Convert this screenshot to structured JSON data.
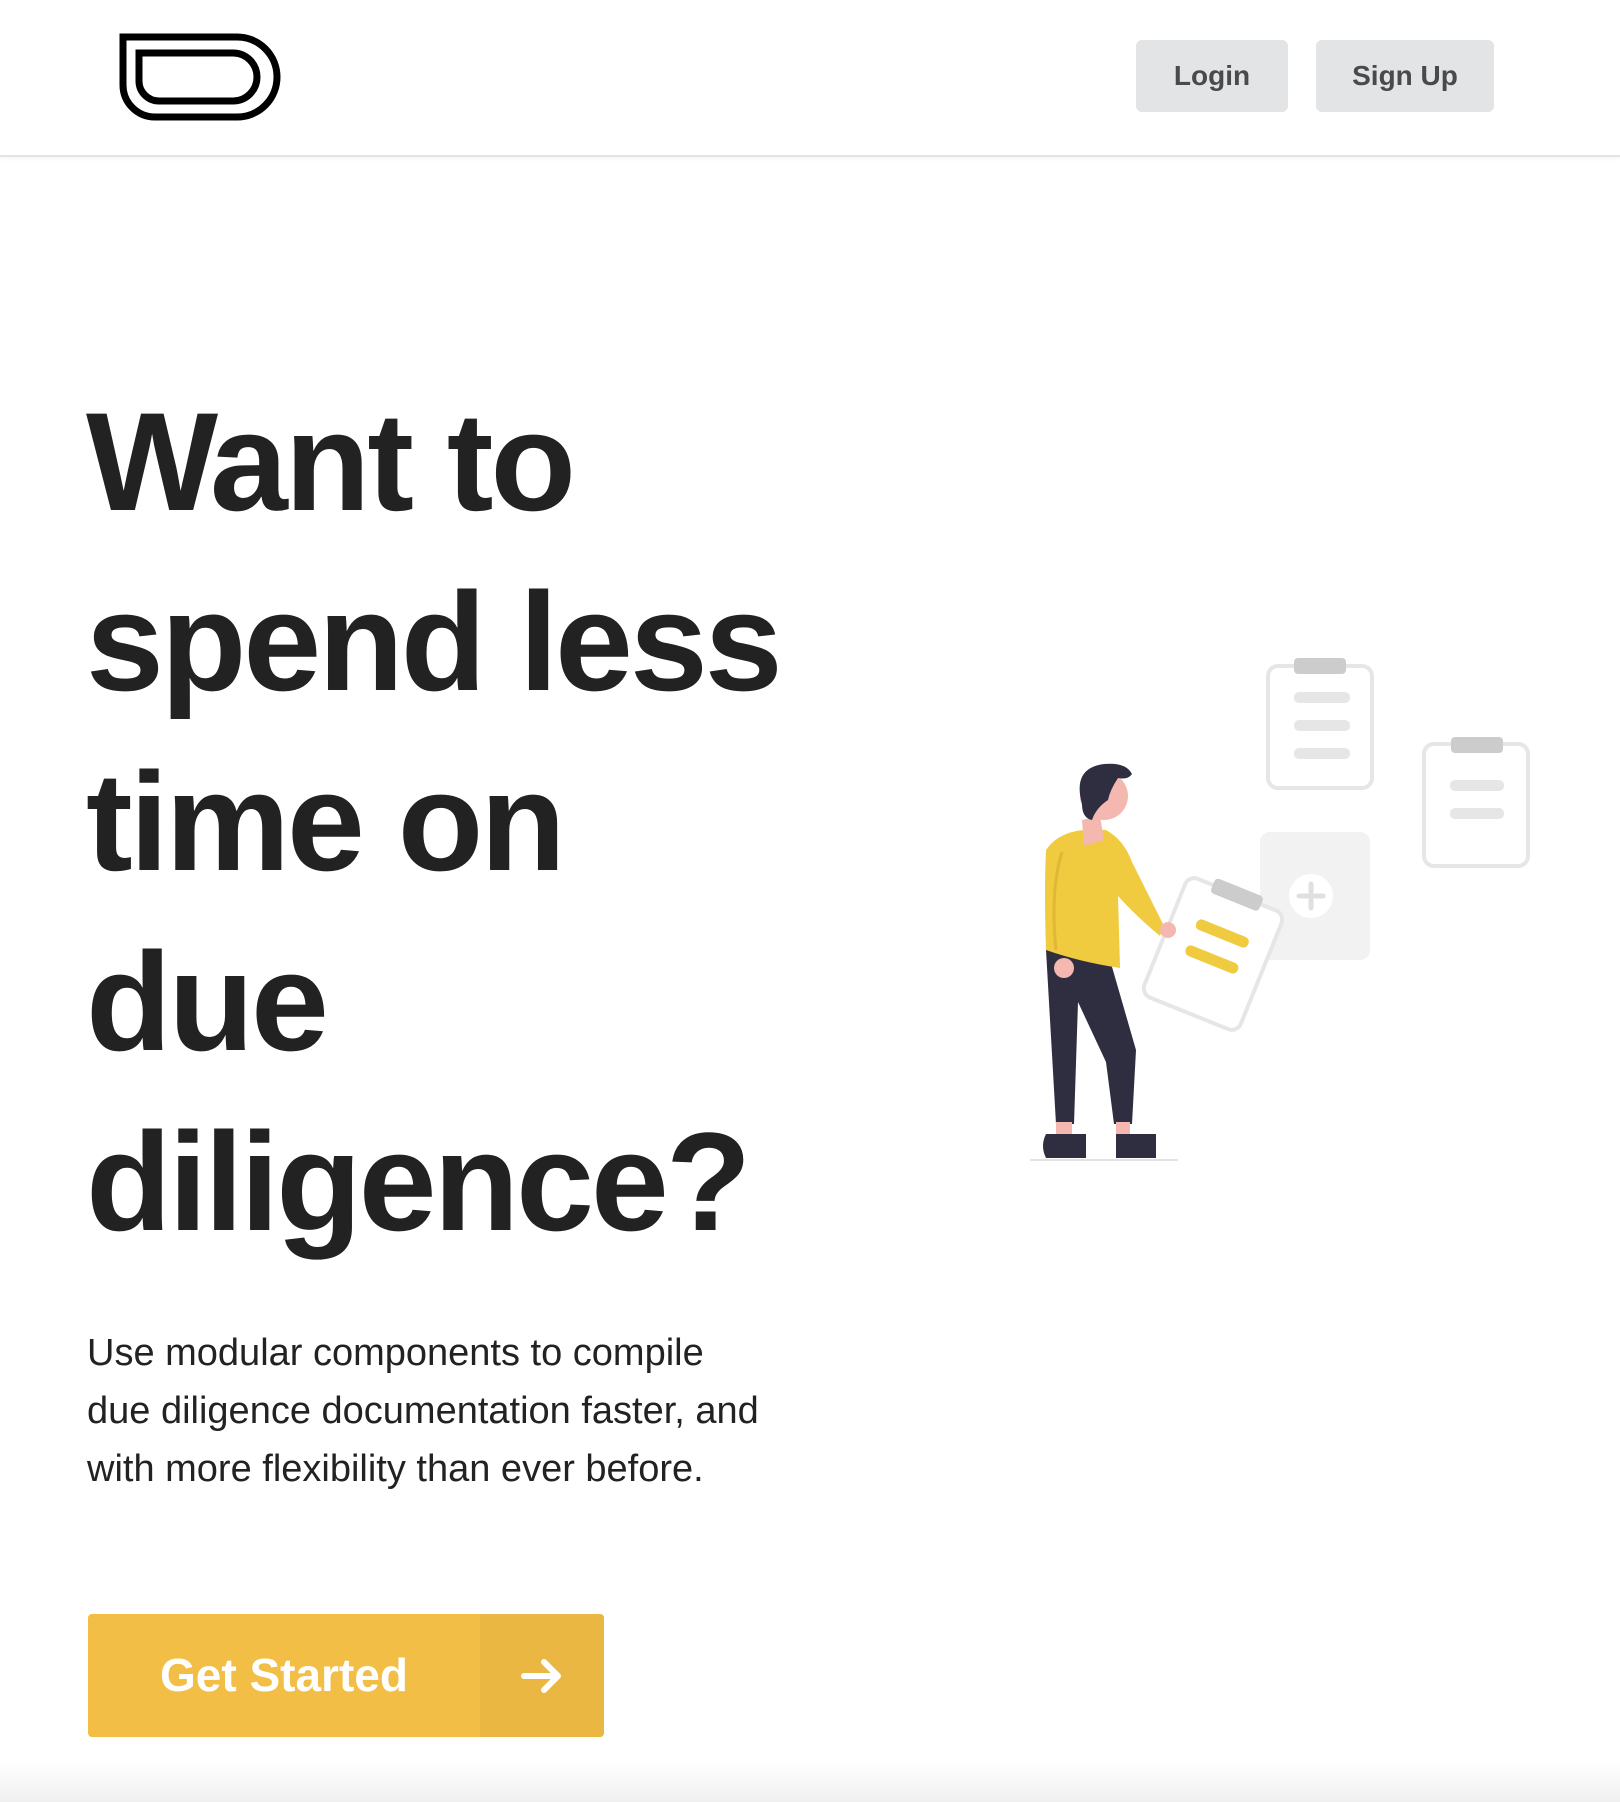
{
  "header": {
    "logo_icon": "rounded-rectangle-logo-icon",
    "login_label": "Login",
    "signup_label": "Sign Up"
  },
  "hero": {
    "title": "Want to spend less time on due diligence?",
    "subtitle": "Use modular components to compile due diligence documentation faster, and with more flexibility than ever before.",
    "cta_label": "Get Started",
    "cta_icon": "arrow-right-icon",
    "illustration_icon": "person-with-clipboards-illustration"
  },
  "colors": {
    "accent": "#f2be45",
    "accent_dark": "#ebb743",
    "text": "#222222",
    "nav_button_bg": "#e3e4e6",
    "figure_shirt": "#f0ca3f",
    "figure_pants": "#2f2e41",
    "figure_skin": "#f4b8b0"
  }
}
